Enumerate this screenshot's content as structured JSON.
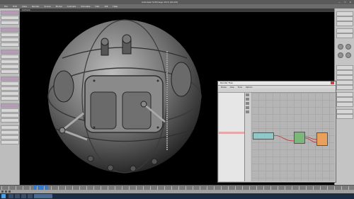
{
  "window": {
    "title": "Autodesk Softimage 2014 (64-bit)",
    "controls": "— ☐ ✕"
  },
  "menu": [
    "File",
    "Edit",
    "View",
    "Render",
    "Scene",
    "Model",
    "Animate",
    "Simulate",
    "Hair",
    "ICE",
    "Help"
  ],
  "viewport": {
    "label": "Camera"
  },
  "render_tree": {
    "title": "Render Tree",
    "menu": [
      "Nodes",
      "View",
      "Tools",
      "Options"
    ],
    "list_items": [
      "",
      "",
      "",
      "",
      "",
      "",
      "",
      "",
      "",
      "",
      "",
      "",
      "",
      "",
      "",
      "",
      "",
      "",
      "",
      "",
      "",
      "",
      "",
      "",
      "",
      "",
      "",
      "",
      "",
      "",
      "",
      ""
    ],
    "selected_index": 16,
    "nodes": [
      {
        "label": "",
        "color": "#8ec8c8"
      },
      {
        "label": "",
        "color": "#7ab87a"
      },
      {
        "label": "",
        "color": "#e8a05a"
      }
    ]
  },
  "taskbar": {
    "clock": ""
  },
  "colors": {
    "accent": "#b99ab9",
    "timeline_cursor": "#3a7ac6",
    "viewport_bg": "#000000"
  }
}
